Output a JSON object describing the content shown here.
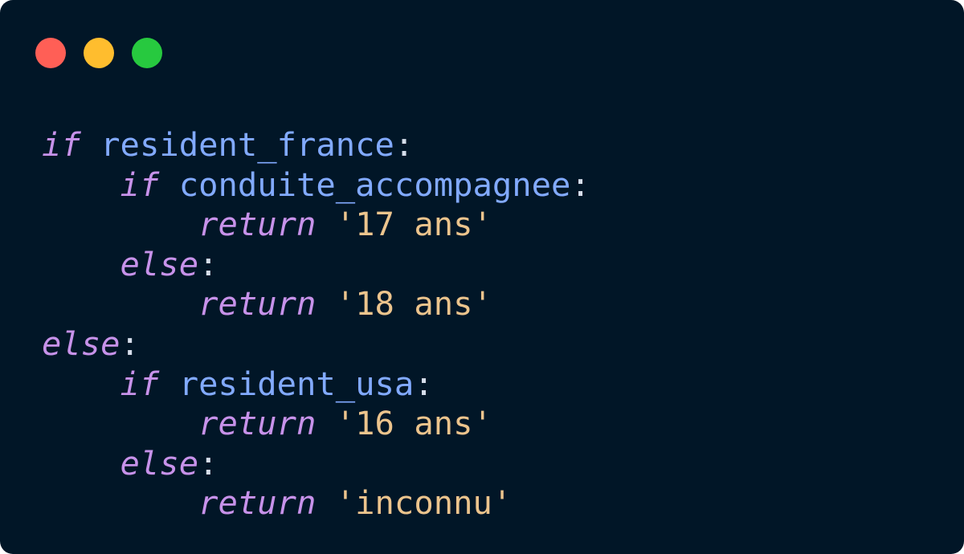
{
  "window_controls": {
    "close_color": "#ff5f56",
    "minimize_color": "#ffbd2e",
    "maximize_color": "#27c93f"
  },
  "code": {
    "language": "python",
    "lines": [
      [
        {
          "t": "if",
          "c": "kw"
        },
        {
          "t": " "
        },
        {
          "t": "resident_france",
          "c": "id"
        },
        {
          "t": ":",
          "c": "pun"
        }
      ],
      [
        {
          "t": "    "
        },
        {
          "t": "if",
          "c": "kw"
        },
        {
          "t": " "
        },
        {
          "t": "conduite_accompagnee",
          "c": "id"
        },
        {
          "t": ":",
          "c": "pun"
        }
      ],
      [
        {
          "t": "        "
        },
        {
          "t": "return",
          "c": "kw"
        },
        {
          "t": " "
        },
        {
          "t": "'17 ans'",
          "c": "str"
        }
      ],
      [
        {
          "t": "    "
        },
        {
          "t": "else",
          "c": "kw"
        },
        {
          "t": ":",
          "c": "pun"
        }
      ],
      [
        {
          "t": "        "
        },
        {
          "t": "return",
          "c": "kw"
        },
        {
          "t": " "
        },
        {
          "t": "'18 ans'",
          "c": "str"
        }
      ],
      [
        {
          "t": "else",
          "c": "kw"
        },
        {
          "t": ":",
          "c": "pun"
        }
      ],
      [
        {
          "t": "    "
        },
        {
          "t": "if",
          "c": "kw"
        },
        {
          "t": " "
        },
        {
          "t": "resident_usa",
          "c": "id"
        },
        {
          "t": ":",
          "c": "pun"
        }
      ],
      [
        {
          "t": "        "
        },
        {
          "t": "return",
          "c": "kw"
        },
        {
          "t": " "
        },
        {
          "t": "'16 ans'",
          "c": "str"
        }
      ],
      [
        {
          "t": "    "
        },
        {
          "t": "else",
          "c": "kw"
        },
        {
          "t": ":",
          "c": "pun"
        }
      ],
      [
        {
          "t": "        "
        },
        {
          "t": "return",
          "c": "kw"
        },
        {
          "t": " "
        },
        {
          "t": "'inconnu'",
          "c": "str"
        }
      ]
    ]
  }
}
